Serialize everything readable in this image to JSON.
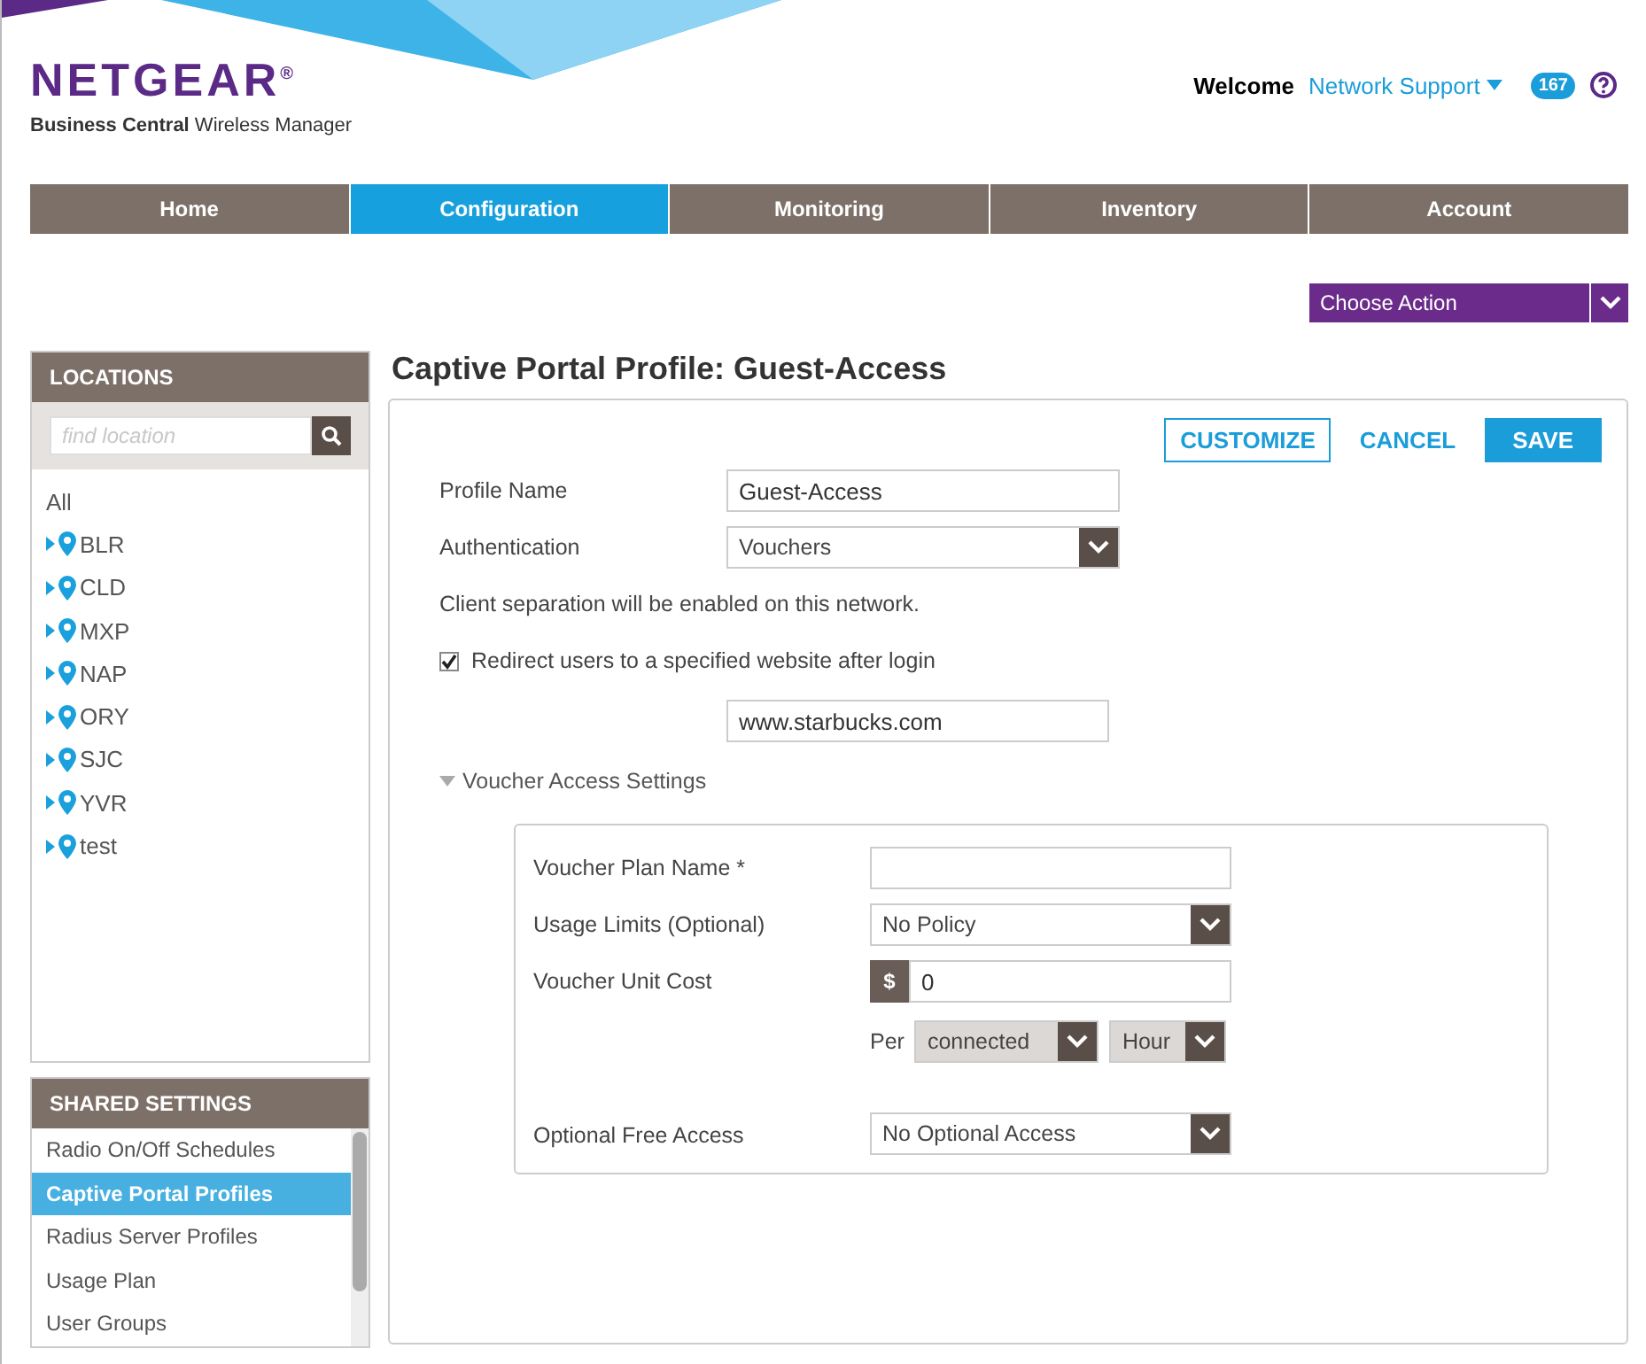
{
  "brand": {
    "logo": "NETGEAR",
    "trademark": "®",
    "product_bold": "Business Central",
    "product_rest": "Wireless Manager"
  },
  "user": {
    "welcome": "Welcome",
    "name": "Network Support",
    "badge": "167"
  },
  "nav": [
    {
      "label": "Home",
      "selected": false
    },
    {
      "label": "Configuration",
      "selected": true
    },
    {
      "label": "Monitoring",
      "selected": false
    },
    {
      "label": "Inventory",
      "selected": false
    },
    {
      "label": "Account",
      "selected": false
    }
  ],
  "action_menu": {
    "label": "Choose Action"
  },
  "locations": {
    "title": "LOCATIONS",
    "search_placeholder": "find location",
    "all": "All",
    "items": [
      "BLR",
      "CLD",
      "MXP",
      "NAP",
      "ORY",
      "SJC",
      "YVR",
      "test"
    ]
  },
  "shared_settings": {
    "title": "SHARED SETTINGS",
    "items": [
      {
        "label": "Radio On/Off Schedules",
        "selected": false
      },
      {
        "label": "Captive Portal Profiles",
        "selected": true
      },
      {
        "label": "Radius Server Profiles",
        "selected": false
      },
      {
        "label": "Usage Plan",
        "selected": false
      },
      {
        "label": "User Groups",
        "selected": false
      }
    ]
  },
  "page_title": "Captive Portal Profile: Guest-Access",
  "buttons": {
    "customize": "CUSTOMIZE",
    "cancel": "CANCEL",
    "save": "SAVE"
  },
  "form": {
    "profile_name_label": "Profile Name",
    "profile_name": "Guest-Access",
    "authentication_label": "Authentication",
    "authentication": "Vouchers",
    "note": "Client separation will be enabled on this network.",
    "redirect_label": "Redirect users to a specified website after login",
    "redirect_checked": true,
    "redirect_url": "www.starbucks.com"
  },
  "voucher": {
    "title": "Voucher Access Settings",
    "expanded": true,
    "plan_name_label": "Voucher Plan Name *",
    "usage_label": "Usage Limits (Optional)",
    "usage": "No Policy",
    "cost_label": "Voucher Unit Cost",
    "currency": "$",
    "cost": "0",
    "per_label": "Per",
    "per_mode": "connected",
    "per_unit": "Hour",
    "free_label": "Optional Free Access",
    "free": "No Optional Access"
  }
}
